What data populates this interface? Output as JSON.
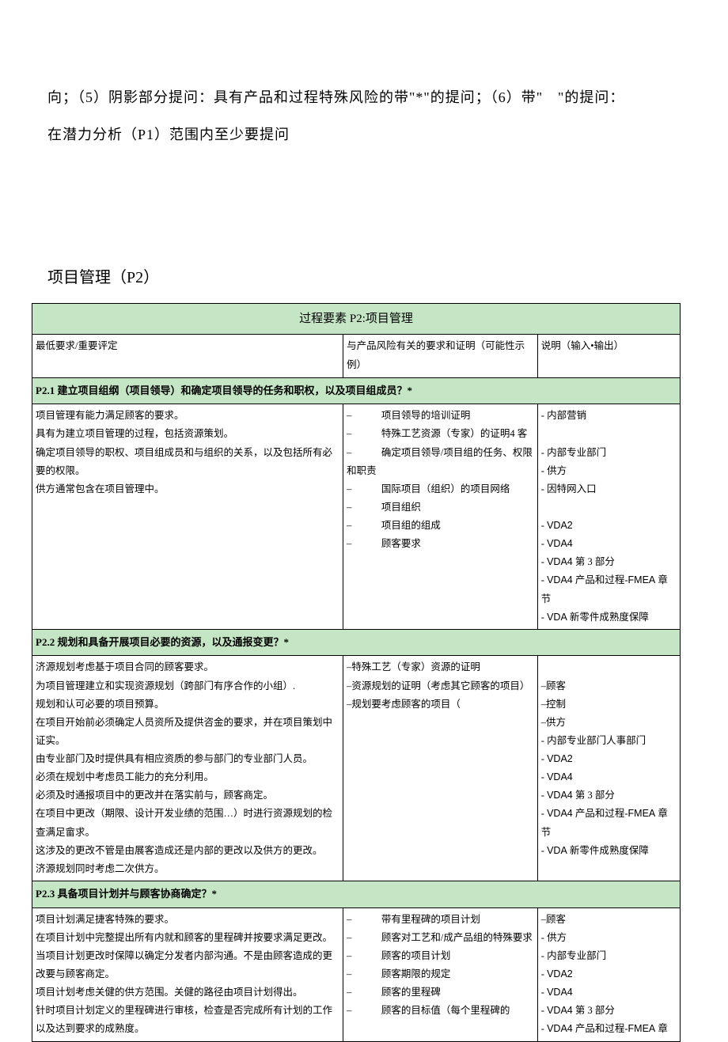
{
  "intro": {
    "line1": "向；（5）阴影部分提问：具有产品和过程特殊风险的带\"*\"的提问；（6）带\"　\"的提问：",
    "line2": "在潜力分析（P1）范围内至少要提问"
  },
  "sectionTitle": "项目管理（P2）",
  "table": {
    "title": "过程要素 P2:项目管理",
    "headers": {
      "col1": "最低要求/重要评定",
      "col2": "与产品风险有关的要求和证明（可能性示例）",
      "col3": "说明（输入•输出）"
    },
    "p21": {
      "heading": "P2.1 建立项目组纲（项目领导）和确定项目领导的任务和职权，以及项目组成员？*",
      "col1_lines": [
        "项目管理有能力满足顾客的要求。",
        "具有为建立项目管理的过程，包括资源策划。",
        "确定项目领导的职权、项目组成员和与组织的关系，以及包括所有必要的权限。",
        "供方通常包含在项目管理中。"
      ],
      "col2_lines": [
        "–　　　项目领导的培训证明",
        "–　　　特殊工艺资源（专家）的证明4 客",
        "–　　　确定项目领导/项目组的任务、权限和职责",
        "–　　　国际项目（组织）的项目网络",
        "–　　　项目组织",
        "–　　　项目组的组成",
        "–　　　顾客要求"
      ],
      "col3_lines": [
        "- 内部营销",
        "",
        "- 内部专业部门",
        "- 供方",
        "- 因特网入口",
        "",
        "- VDA2",
        "- VDA4",
        "- VDA4 第 3 部分",
        "- VDA4 产品和过程-FMEA 章节",
        "- VDA 新零件成熟度保障"
      ]
    },
    "p22": {
      "heading": "P2.2 规划和具备开展项目必要的资源，以及通报变更？*",
      "col1_lines": [
        "济源规划考虑基于项目合同的顾客要求。",
        "为项目管理建立和实现资源规划（跨部门有序合作的小组）.",
        "规划和认可必要的项目预算。",
        "在项目开始前必须确定人员资所及提供咨金的要求，并在项目策划中证实。",
        "由专业部门及时提供具有相应资质的参与部门的专业部门人员。",
        "必须在规划中考虑员工能力的充分利用。",
        "必须及时通报项目中的更改并在落实前与，顾客商定。",
        "在项目中更改（期限、设计开发业绩的范围…）时进行资源规划的检查满足畲求。",
        "这涉及的更改不管是由展客造成还是内部的更改以及供方的更改。",
        "济源规划同时考虑二次供方。"
      ],
      "col2_lines": [
        "–特殊工艺（专家）资源的证明",
        "–资源规划的证明（考虑其它顾客的项目）",
        "–规划要考虑顾客的项目（"
      ],
      "col3_lines": [
        "",
        "–顾客",
        "–控制",
        "–供方",
        "- 内部专业部门人事部门",
        "- VDA2",
        "- VDA4",
        "- VDA4 第 3 部分",
        "- VDA4 产品和过程-FMEA 章节",
        "- VDA 新零件成熟度保障"
      ]
    },
    "p23": {
      "heading": "P2.3 具备项目计划并与顾客协商确定？*",
      "col1_lines": [
        "项目计划满足捷客特殊的要求。",
        "在项目计划中完整提出所有内就和顾客的里程碑并按要求满足更改。",
        "当项目计划更改时保障以确定分发者内部沟通。不是由顾客造成的更改要与顾客商定。",
        "项目计划考虑关健的供方范围。关健的路径由项目计划得出。",
        "针时项目计划定义的里程碑进行审核，检查是否完成所有计划的工作以及达到要求的成熟度。"
      ],
      "col2_lines": [
        "–　　　带有里程碑的项目计划",
        "–　　　顾客对工艺和/成产品组的特殊要求",
        "–　　　顾客的项目计划",
        "–　　　顾客期限的规定",
        "–　　　顾客的里程碑",
        "–　　　顾客的目标值（每个里程碑的"
      ],
      "col3_lines": [
        "–顾客",
        "- 供方",
        "- 内部专业部门",
        "- VDA2",
        "- VDA4",
        "- VDA4 第 3 部分",
        "- VDA4 产品和过程-FMEA 章"
      ]
    }
  }
}
